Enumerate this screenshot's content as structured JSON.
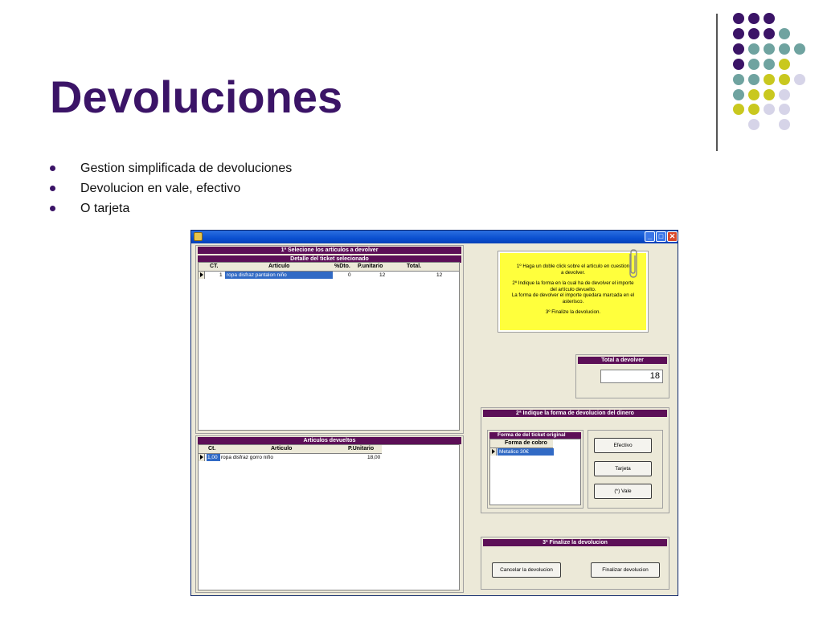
{
  "slide": {
    "title": "Devoluciones",
    "bullets": [
      "Gestion simplificada de devoluciones",
      "Devolucion en vale, efectivo",
      "O tarjeta"
    ],
    "colors": {
      "purple": "#3b1467",
      "teal": "#6fa3a0",
      "lime": "#c9c81f",
      "lavender": "#d6d4e8"
    }
  },
  "window": {
    "controls": {
      "minimize": "_",
      "maximize": "□",
      "close": "✕"
    },
    "section1": {
      "header": "1ª Selecione los artículos a devolver",
      "ticket_header": "Detalle del ticket selecionado",
      "columns": [
        "CT.",
        "Articulo",
        "%Dto.",
        "P.unitario",
        "Total."
      ],
      "rows": [
        {
          "ct": "1",
          "articulo": "ropa disfraz pantalon niño",
          "dto": "0",
          "punitario": "12",
          "total": "12"
        }
      ]
    },
    "returned": {
      "header": "Articulos devueltos",
      "columns": [
        "Ct.",
        "Articulo",
        "P.Unitario"
      ],
      "rows": [
        {
          "ct": "1,00",
          "articulo": "ropa disfraz gorro niño",
          "punitario": "18,00"
        }
      ]
    },
    "note": {
      "lines": [
        "1º Haga un doble click sobre el articulo en cuestion",
        "a  devolver.",
        "",
        "2º Indique la forma en la cual ha de devolver el importe",
        "del artículo  devuelto.",
        "La forma de devolver el importe quedara marcada en el",
        "asterisco.",
        "",
        "3º Finalize la devolucion."
      ]
    },
    "total": {
      "header": "Total a devolver",
      "value": "18"
    },
    "section2": {
      "header": "2ª Indique la forma de devolucion del dinero",
      "original_header": "Forma de del ticket original",
      "original_column": "Forma de cobro",
      "original_rows": [
        "Metalico 30€"
      ],
      "buttons": [
        "Efectivo",
        "Tarjeta",
        "(*) Vale"
      ]
    },
    "section3": {
      "header": "3ª Finalize la devolucion",
      "cancel_label": "Cancelar la devolucion",
      "finish_label": "Finalizar devolucion"
    }
  }
}
